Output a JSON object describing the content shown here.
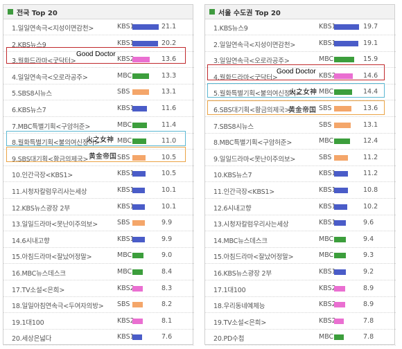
{
  "panels": [
    {
      "title": "전국 Top 20",
      "rows": [
        {
          "label": "1.일일연속극<지성이면감천>",
          "channel": "KBS1",
          "rating": "21.1",
          "value": 21.1,
          "type": "kbs1"
        },
        {
          "label": "2.KBS뉴스9",
          "channel": "KBS1",
          "rating": "20.2",
          "value": 20.2,
          "type": "kbs1"
        },
        {
          "label": "3.월화드라마<굿닥터>",
          "channel": "KBS2",
          "rating": "13.6",
          "value": 13.6,
          "type": "kbs2"
        },
        {
          "label": "4.일일연속극<오로라공주>",
          "channel": "MBC",
          "rating": "13.3",
          "value": 13.3,
          "type": "mbc"
        },
        {
          "label": "5.SBS8시뉴스",
          "channel": "SBS",
          "rating": "13.1",
          "value": 13.1,
          "type": "sbs"
        },
        {
          "label": "6.KBS뉴스7",
          "channel": "KBS1",
          "rating": "11.6",
          "value": 11.6,
          "type": "kbs1"
        },
        {
          "label": "7.MBC특별기획<구암허준>",
          "channel": "MBC",
          "rating": "11.4",
          "value": 11.4,
          "type": "mbc"
        },
        {
          "label": "8.월화특별기획<불의여신정이>",
          "channel": "MBC",
          "rating": "11.0",
          "value": 11.0,
          "type": "mbc"
        },
        {
          "label": "9.SBS대기획<황금의제국>",
          "channel": "SBS",
          "rating": "10.5",
          "value": 10.5,
          "type": "sbs"
        },
        {
          "label": "10.인간극장<KBS1>",
          "channel": "KBS1",
          "rating": "10.5",
          "value": 10.5,
          "type": "kbs1"
        },
        {
          "label": "11.시청자칼럼우리사는세상",
          "channel": "KBS1",
          "rating": "10.1",
          "value": 10.1,
          "type": "kbs1"
        },
        {
          "label": "12.KBS뉴스광장 2부",
          "channel": "KBS1",
          "rating": "10.1",
          "value": 10.1,
          "type": "kbs1"
        },
        {
          "label": "13.일일드라마<못난이주의보>",
          "channel": "SBS",
          "rating": "9.9",
          "value": 9.9,
          "type": "sbs"
        },
        {
          "label": "14.6시내고향",
          "channel": "KBS1",
          "rating": "9.9",
          "value": 9.9,
          "type": "kbs1"
        },
        {
          "label": "15.아침드라마<잘났어정말>",
          "channel": "MBC",
          "rating": "9.0",
          "value": 9.0,
          "type": "mbc"
        },
        {
          "label": "16.MBC뉴스데스크",
          "channel": "MBC",
          "rating": "8.4",
          "value": 8.4,
          "type": "mbc"
        },
        {
          "label": "17.TV소설<은희>",
          "channel": "KBS2",
          "rating": "8.3",
          "value": 8.3,
          "type": "kbs2"
        },
        {
          "label": "18.일일아침연속극<두여자의방>",
          "channel": "SBS",
          "rating": "8.2",
          "value": 8.2,
          "type": "sbs"
        },
        {
          "label": "19.1대100",
          "channel": "KBS2",
          "rating": "8.1",
          "value": 8.1,
          "type": "kbs2"
        },
        {
          "label": "20.세상은넓다",
          "channel": "KBS1",
          "rating": "7.6",
          "value": 7.6,
          "type": "kbs1"
        }
      ]
    },
    {
      "title": "서울 수도권 Top 20",
      "rows": [
        {
          "label": "1.KBS뉴스9",
          "channel": "KBS1",
          "rating": "19.7",
          "value": 19.7,
          "type": "kbs1"
        },
        {
          "label": "2.일일연속극<지성이면감천>",
          "channel": "KBS1",
          "rating": "19.1",
          "value": 19.1,
          "type": "kbs1"
        },
        {
          "label": "3.일일연속극<오로라공주>",
          "channel": "MBC",
          "rating": "15.9",
          "value": 15.9,
          "type": "mbc"
        },
        {
          "label": "4.월화드라마<굿닥터>",
          "channel": "KBS2",
          "rating": "14.6",
          "value": 14.6,
          "type": "kbs2"
        },
        {
          "label": "5.월화특별기획<불의여신정이>",
          "channel": "MBC",
          "rating": "14.4",
          "value": 14.4,
          "type": "mbc"
        },
        {
          "label": "6.SBS대기획<황금의제국>",
          "channel": "SBS",
          "rating": "13.6",
          "value": 13.6,
          "type": "sbs"
        },
        {
          "label": "7.SBS8시뉴스",
          "channel": "SBS",
          "rating": "13.1",
          "value": 13.1,
          "type": "sbs"
        },
        {
          "label": "8.MBC특별기획<구암허준>",
          "channel": "MBC",
          "rating": "12.4",
          "value": 12.4,
          "type": "mbc"
        },
        {
          "label": "9.일일드라마<못난이주의보>",
          "channel": "SBS",
          "rating": "11.2",
          "value": 11.2,
          "type": "sbs"
        },
        {
          "label": "10.KBS뉴스7",
          "channel": "KBS1",
          "rating": "11.2",
          "value": 11.2,
          "type": "kbs1"
        },
        {
          "label": "11.인간극장<KBS1>",
          "channel": "KBS1",
          "rating": "10.8",
          "value": 10.8,
          "type": "kbs1"
        },
        {
          "label": "12.6시내고향",
          "channel": "KBS1",
          "rating": "10.2",
          "value": 10.2,
          "type": "kbs1"
        },
        {
          "label": "13.시청자칼럼우리사는세상",
          "channel": "KBS1",
          "rating": "9.6",
          "value": 9.6,
          "type": "kbs1"
        },
        {
          "label": "14.MBC뉴스데스크",
          "channel": "MBC",
          "rating": "9.4",
          "value": 9.4,
          "type": "mbc"
        },
        {
          "label": "15.아침드라마<잘났어정말>",
          "channel": "MBC",
          "rating": "9.3",
          "value": 9.3,
          "type": "mbc"
        },
        {
          "label": "16.KBS뉴스광장 2부",
          "channel": "KBS1",
          "rating": "9.2",
          "value": 9.2,
          "type": "kbs1"
        },
        {
          "label": "17.1대100",
          "channel": "KBS2",
          "rating": "8.9",
          "value": 8.9,
          "type": "kbs2"
        },
        {
          "label": "18.우리동네예체능",
          "channel": "KBS2",
          "rating": "8.9",
          "value": 8.9,
          "type": "kbs2"
        },
        {
          "label": "19.TV소설<은희>",
          "channel": "KBS2",
          "rating": "7.8",
          "value": 7.8,
          "type": "kbs2"
        },
        {
          "label": "20.PD수첩",
          "channel": "MBC",
          "rating": "7.8",
          "value": 7.8,
          "type": "mbc"
        }
      ]
    }
  ],
  "annotations": {
    "good_doctor": "Good Doctor",
    "goddess_of_fire": "火之女神",
    "empire_of_gold": "黄金帝国"
  },
  "colors": {
    "kbs1": "#4a5cc8",
    "kbs2": "#ea6fd1",
    "mbc": "#3c9e3c",
    "sbs": "#f4a66a",
    "highlight_red": "#c0282b",
    "highlight_cyan": "#5bb7d2",
    "highlight_orange": "#eaa345"
  }
}
